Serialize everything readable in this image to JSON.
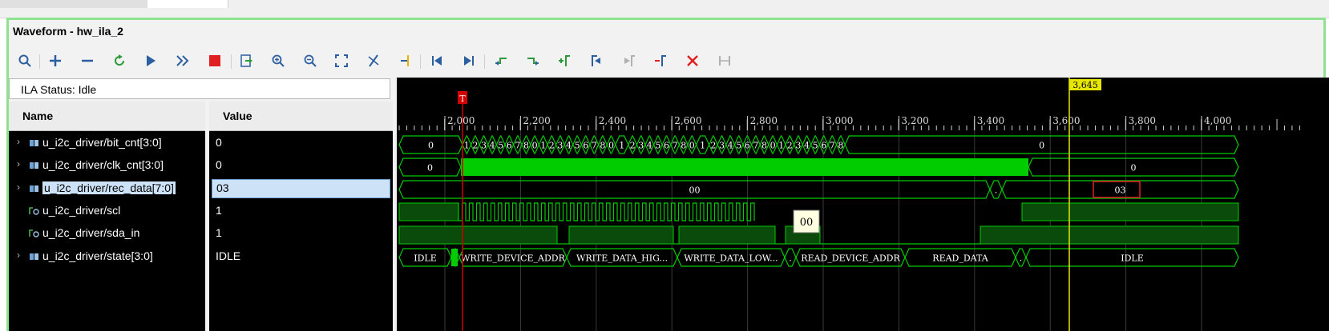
{
  "window": {
    "title": "Waveform - hw_ila_2"
  },
  "toolbar": {
    "buttons": [
      "search-icon",
      "add-icon",
      "remove-icon",
      "refresh-icon",
      "run-trigger-icon",
      "run-immediate-icon",
      "stop-icon",
      "export-icon",
      "zoom-in-icon",
      "zoom-out-icon",
      "zoom-fit-icon",
      "cursor-remove-icon",
      "go-to-cursor-icon",
      "go-to-start-icon",
      "go-to-end-icon",
      "previous-transition-icon",
      "next-transition-icon",
      "add-marker-icon",
      "previous-marker-icon",
      "next-marker-icon",
      "delete-marker-icon",
      "delete-all-icon",
      "swap-icon"
    ]
  },
  "status": {
    "text": "ILA Status:  Idle"
  },
  "columns": {
    "name": "Name",
    "value": "Value"
  },
  "signals": [
    {
      "name": "u_i2c_driver/bit_cnt[3:0]",
      "value": "0",
      "expandable": true,
      "type": "bus"
    },
    {
      "name": "u_i2c_driver/clk_cnt[3:0]",
      "value": "0",
      "expandable": true,
      "type": "bus"
    },
    {
      "name": "u_i2c_driver/rec_data[7:0]",
      "value": "03",
      "expandable": true,
      "type": "bus",
      "selected": true
    },
    {
      "name": "u_i2c_driver/scl",
      "value": "1",
      "expandable": false,
      "type": "bit"
    },
    {
      "name": "u_i2c_driver/sda_in",
      "value": "1",
      "expandable": false,
      "type": "bit"
    },
    {
      "name": "u_i2c_driver/state[3:0]",
      "value": "IDLE",
      "expandable": true,
      "type": "bus"
    }
  ],
  "waveform": {
    "cursor_label": "3,645",
    "trigger_label": "T",
    "tooltip": "00",
    "ruler_labels": [
      "2,000",
      "2,200",
      "2,400",
      "2,600",
      "2,800",
      "3,000",
      "3,200",
      "3,400",
      "3,600",
      "3,800",
      "4,000"
    ],
    "bit_cnt_labels": [
      "0",
      "1",
      "2",
      "3",
      "4",
      "5",
      "6",
      "7",
      "8",
      "0",
      "1",
      "2",
      "3",
      "4",
      "5",
      "6",
      "7",
      "8",
      "0",
      "1",
      "2",
      "3",
      "4",
      "5",
      "6",
      "7",
      "8",
      "0",
      "1",
      "2",
      "3",
      "4",
      "5",
      "6",
      "7",
      "8",
      "0",
      "1",
      "2",
      "3",
      "4",
      "5",
      "6",
      "7",
      "8",
      "0"
    ],
    "clk_cnt_labels": [
      "0",
      "0"
    ],
    "rec_data_labels": [
      "00",
      ".",
      "03"
    ],
    "state_labels": [
      "IDLE",
      "WRITE_DEVICE_ADDR",
      "WRITE_DATA_HIG...",
      "WRITE_DATA_LOW...",
      ".",
      "READ_DEVICE_ADDR",
      "READ_DATA",
      ".",
      "IDLE"
    ]
  },
  "colors": {
    "wave": "#00cc00",
    "cursor": "#e6e600",
    "trigger": "#d40000",
    "frame": "#8fe38f"
  }
}
